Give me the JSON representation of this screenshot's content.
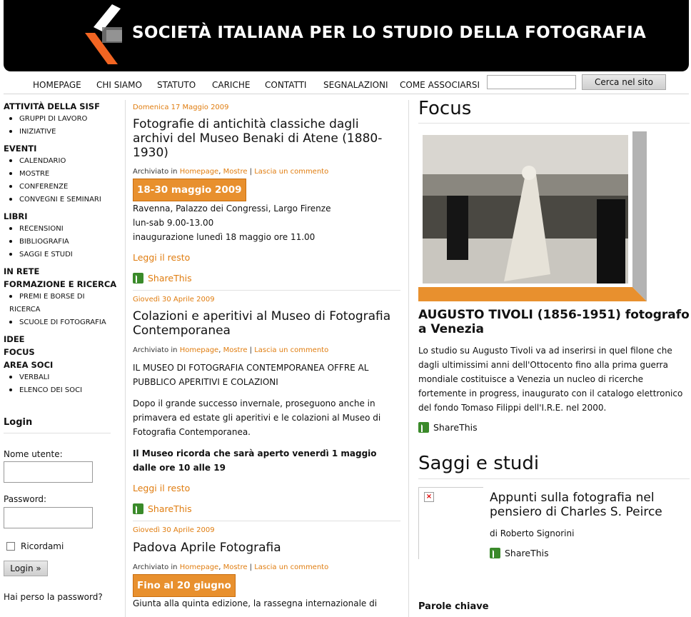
{
  "header": {
    "title": "SOCIETÀ ITALIANA PER LO STUDIO DELLA FOTOGRAFIA",
    "logo": "sisf-logo"
  },
  "nav": {
    "items": [
      "HOMEPAGE",
      "CHI SIAMO",
      "STATUTO",
      "CARICHE",
      "CONTATTI",
      "SEGNALAZIONI",
      "COME ASSOCIARSI"
    ],
    "search_value": "",
    "search_button": "Cerca nel sito"
  },
  "sidebar": {
    "sections": [
      {
        "label": "ATTIVITÀ DELLA SISF",
        "items": [
          "GRUPPI DI LAVORO",
          "INIZIATIVE"
        ]
      },
      {
        "label": "EVENTI",
        "items": [
          "CALENDARIO",
          "MOSTRE",
          "CONFERENZE",
          "CONVEGNI E SEMINARI"
        ]
      },
      {
        "label": "LIBRI",
        "items": [
          "RECENSIONI",
          "BIBLIOGRAFIA",
          "SAGGI E STUDI"
        ]
      },
      {
        "label": "IN RETE",
        "items": []
      },
      {
        "label": "FORMAZIONE E RICERCA",
        "items": [
          "PREMI E BORSE DI",
          "RICERCA",
          "SCUOLE DI FOTOGRAFIA"
        ]
      },
      {
        "label": "IDEE",
        "items": []
      },
      {
        "label": "FOCUS",
        "items": []
      },
      {
        "label": "AREA SOCI",
        "items": [
          "VERBALI",
          "ELENCO DEI SOCI"
        ]
      }
    ],
    "login": {
      "title": "Login",
      "username_label": "Nome utente:",
      "password_label": "Password:",
      "remember_label": "Ricordami",
      "login_button": "Login »",
      "forgot_link": "Hai perso la password?"
    }
  },
  "posts": [
    {
      "date": "Domenica 17 Maggio 2009",
      "title": "Fotografie di antichità classiche dagli archivi del Museo Benaki di Atene (1880-1930)",
      "archived": "Archiviato in",
      "cat1": "Homepage",
      "cat2": "Mostre",
      "comment": "Lascia un commento",
      "badge": "18-30 maggio 2009",
      "lines": [
        "Ravenna, Palazzo dei Congressi, Largo Firenze",
        "lun-sab 9.00-13.00",
        "inaugurazione lunedì 18 maggio ore 11.00"
      ],
      "more": "Leggi il resto",
      "share": "ShareThis"
    },
    {
      "date": "Giovedì 30 Aprile 2009",
      "title": "Colazioni e aperitivi al Museo di Fotografia Contemporanea",
      "archived": "Archiviato in",
      "cat1": "Homepage",
      "cat2": "Mostre",
      "comment": "Lascia un commento",
      "p1": "IL MUSEO DI FOTOGRAFIA CONTEMPORANEA OFFRE AL PUBBLICO APERITIVI E COLAZIONI",
      "p2": "Dopo il grande successo invernale, proseguono anche in primavera ed estate gli aperitivi e le colazioni al Museo di Fotografia Contemporanea.",
      "p3": "Il Museo ricorda che sarà aperto venerdì 1 maggio dalle ore 10 alle 19",
      "more": "Leggi il resto",
      "share": "ShareThis"
    },
    {
      "date": "Giovedì 30 Aprile 2009",
      "title": "Padova Aprile Fotografia",
      "archived": "Archiviato in",
      "cat1": "Homepage",
      "cat2": "Mostre",
      "comment": "Lascia un commento",
      "badge": "Fino al 20 giugno",
      "p1": "Giunta alla quinta edizione, la rassegna internazionale di"
    }
  ],
  "focus": {
    "heading": "Focus",
    "title": "AUGUSTO TIVOLI (1856-1951) fotografo a Venezia",
    "body": "Lo studio su Augusto Tivoli va ad inserirsi in quel filone che dagli ultimissimi anni dell'Ottocento fino alla prima guerra mondiale costituisce a Venezia un nucleo di ricerche fortemente in progress, inaugurato con il catalogo elettronico del fondo Tomaso Filippi dell'I.R.E. nel 2000.",
    "share": "ShareThis"
  },
  "saggi": {
    "heading": "Saggi e studi",
    "title": "Appunti sulla fotografia nel pensiero di Charles S. Peirce",
    "author": "di Roberto Signorini",
    "share": "ShareThis"
  },
  "keywords": {
    "heading": "Parole chiave"
  },
  "colors": {
    "accent": "#e07d10",
    "badge": "#e8902e",
    "share_green": "#3a8a2a"
  }
}
